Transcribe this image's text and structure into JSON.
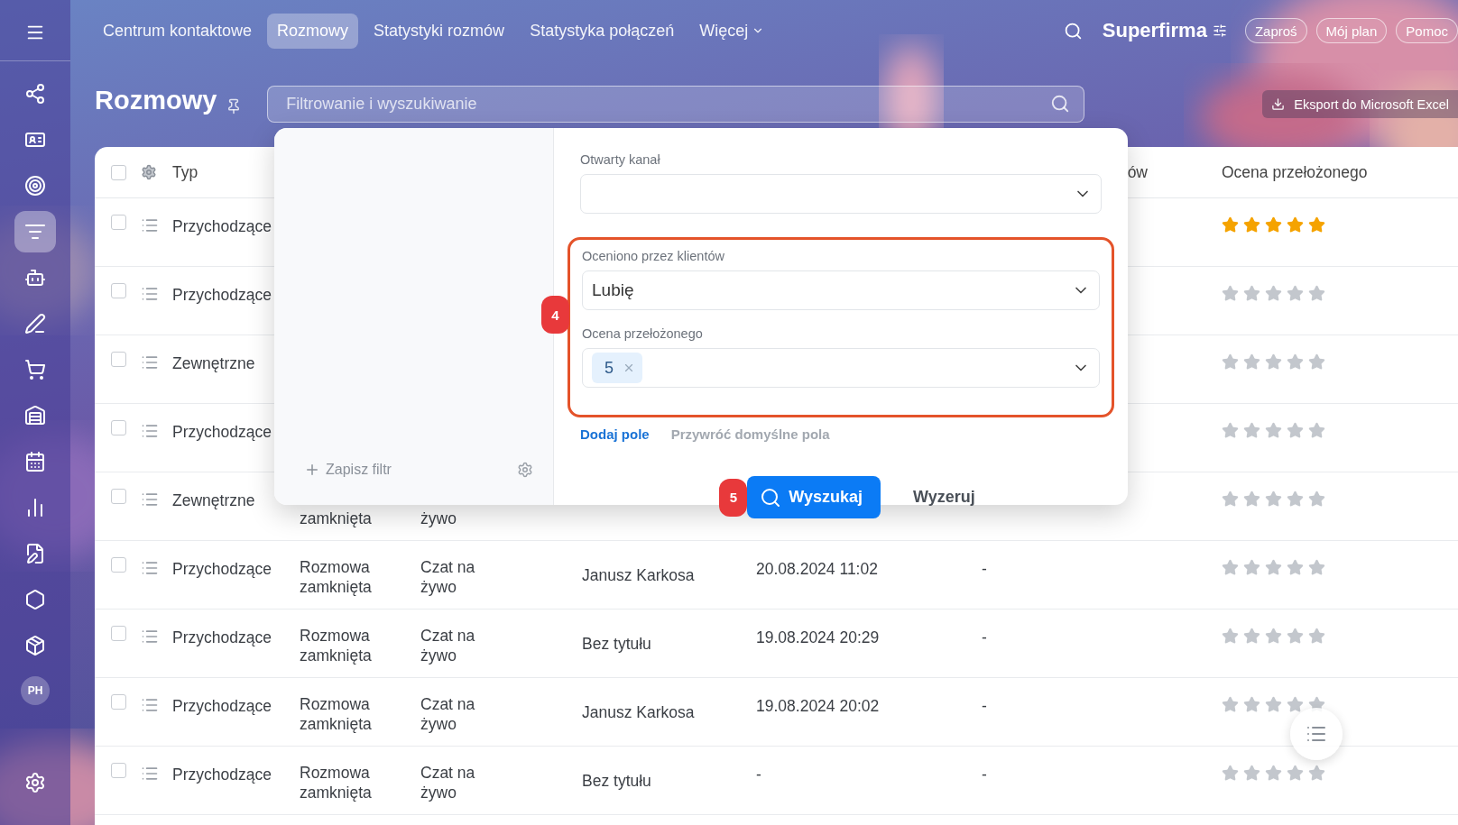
{
  "sidebar": {
    "items": [
      {
        "kind": "icon",
        "selected": false
      },
      {
        "kind": "icon",
        "selected": false
      },
      {
        "kind": "icon",
        "selected": false
      },
      {
        "kind": "icon",
        "selected": true
      },
      {
        "kind": "icon",
        "selected": false
      },
      {
        "kind": "icon",
        "selected": false
      },
      {
        "kind": "icon",
        "selected": false
      },
      {
        "kind": "icon",
        "selected": false
      },
      {
        "kind": "icon",
        "selected": false
      },
      {
        "kind": "icon",
        "selected": false
      },
      {
        "kind": "icon",
        "selected": false
      },
      {
        "kind": "icon",
        "selected": false
      },
      {
        "kind": "icon",
        "selected": false
      },
      {
        "kind": "avatar",
        "label": "PH",
        "selected": false
      }
    ]
  },
  "topbar": {
    "tabs": [
      {
        "label": "Centrum kontaktowe",
        "selected": false,
        "has_menu": false
      },
      {
        "label": "Rozmowy",
        "selected": true,
        "has_menu": false
      },
      {
        "label": "Statystyki rozmów",
        "selected": false,
        "has_menu": false
      },
      {
        "label": "Statystyka połączeń",
        "selected": false,
        "has_menu": false
      },
      {
        "label": "Więcej",
        "selected": false,
        "has_menu": true
      }
    ],
    "company": "Superfirma",
    "buttons": [
      "Zaproś",
      "Mój plan",
      "Pomoc"
    ]
  },
  "page": {
    "title": "Rozmowy",
    "search": {
      "placeholder": "Filtrowanie i wyszukiwanie"
    },
    "export_button": "Eksport do Microsoft Excel"
  },
  "table": {
    "select_all_checked": false,
    "type_column": "Typ",
    "column_8": "ów",
    "rating_column": "Ocena przełożonego",
    "rows": [
      {
        "checked": false,
        "type": "Przychodzące",
        "stars": 5
      },
      {
        "checked": false,
        "type": "Przychodzące",
        "stars": 0
      },
      {
        "checked": false,
        "type": "Zewnętrzne",
        "stars": 0
      },
      {
        "checked": false,
        "type": "Przychodzące",
        "stars": 0
      },
      {
        "checked": false,
        "type": "Zewnętrzne",
        "status": "zamknięta",
        "channel": "żywo",
        "stars": 0
      },
      {
        "checked": false,
        "type": "Przychodzące",
        "status": "Rozmowa zamknięta",
        "channel": "Czat na żywo",
        "name": "Janusz Karkosa",
        "date": "20.08.2024 11:02",
        "column_7": "-",
        "stars": 0
      },
      {
        "checked": false,
        "type": "Przychodzące",
        "status": "Rozmowa zamknięta",
        "channel": "Czat na żywo",
        "name": "Bez tytułu",
        "date": "19.08.2024 20:29",
        "column_7": "-",
        "stars": 0
      },
      {
        "checked": false,
        "type": "Przychodzące",
        "status": "Rozmowa zamknięta",
        "channel": "Czat na żywo",
        "name": "Janusz Karkosa",
        "date": "19.08.2024 20:02",
        "column_7": "-",
        "stars": 0
      },
      {
        "checked": false,
        "type": "Przychodzące",
        "status": "Rozmowa zamknięta",
        "channel": "Czat na żywo",
        "name": "Bez tytułu",
        "date": "-",
        "column_7": "-",
        "stars": 0
      }
    ]
  },
  "filter_popup": {
    "save_filter": "Zapisz filtr",
    "fields": [
      {
        "label": "Otwarty kanał",
        "highlighted": false
      },
      {
        "label": "Oceniono przez klientów",
        "value": "Lubię",
        "highlighted": true
      },
      {
        "label": "Ocena przełożonego",
        "tags": [
          "5"
        ],
        "highlighted": true
      }
    ],
    "highlight_badge": "4",
    "add_field": "Dodaj pole",
    "restore_fields": "Przywróć domyślne pola",
    "search_badge": "5",
    "search_button": "Wyszukaj",
    "reset_button": "Wyzeruj"
  }
}
